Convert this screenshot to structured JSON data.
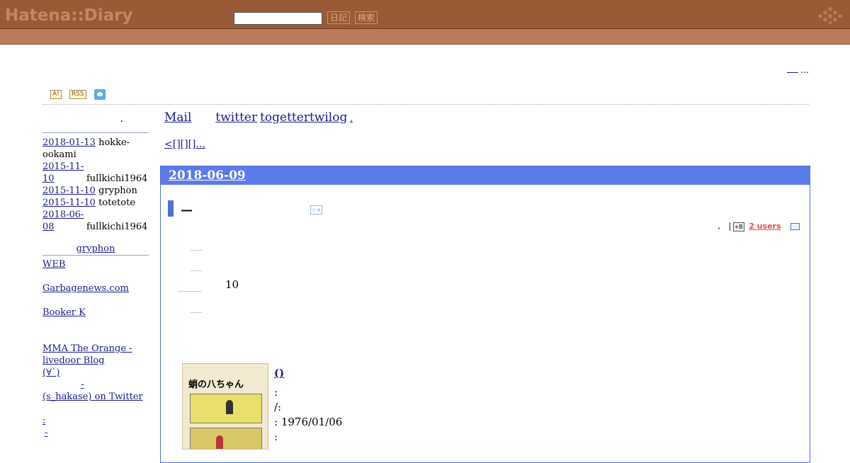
{
  "header": {
    "logo": "Hatena::Diary",
    "search_placeholder": "",
    "diary_button": "日記",
    "search_button": "検索"
  },
  "top_right": {
    "text": "..."
  },
  "badges": {
    "a_badge": "A!",
    "rss_badge": "RSS"
  },
  "sidebar": {
    "title": ".",
    "recent_comments": [
      {
        "date": "2018-01-13",
        "user": "hokke-ookami"
      },
      {
        "date": "2015-11-10",
        "user": "fullkichi1964"
      },
      {
        "date": "2015-11-10",
        "user": "gryphon"
      },
      {
        "date": "2015-11-10",
        "user": "totetote"
      },
      {
        "date": "2018-06-08",
        "user": "fullkichi1964"
      }
    ],
    "sub_title": "gryphon",
    "links": [
      "WEB",
      "",
      "Garbagenews.com",
      "",
      "Booker K",
      "",
      "",
      "MMA The Orange - livedoor Blog",
      "(∀`)",
      "-",
      "(s_hakase) on Twitter",
      "",
      ":",
      "-"
    ]
  },
  "main_nav": {
    "mail": "Mail",
    "twitter": "twitter",
    "togetter": "togettertwilog",
    "dot": ","
  },
  "pager": {
    "text": "<[][][]..."
  },
  "day": {
    "date": "2018-06-09",
    "section_title": "—",
    "star_label": "☆+",
    "meta_comma": ",",
    "bookmark_users": "2 users",
    "bookmark_icon": "+B",
    "body_number": "10",
    "book_title": "()",
    "info_lines": [
      ":",
      "/:",
      ":   1976/01/06",
      ":"
    ],
    "cover_text": "蛸の八ちゃん"
  }
}
